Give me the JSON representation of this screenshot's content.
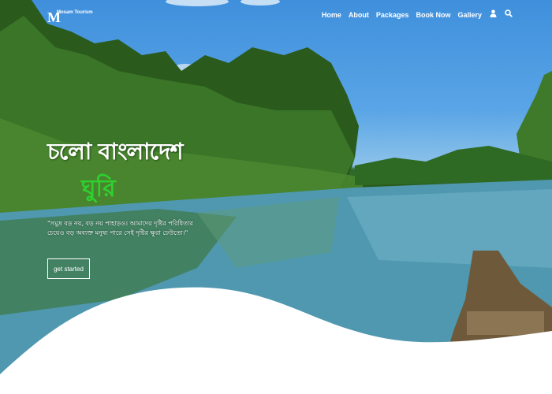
{
  "brand": {
    "logo_text": "Mosam Tourism"
  },
  "nav": {
    "items": [
      "Home",
      "About",
      "Packages",
      "Book Now",
      "Gallery"
    ],
    "user_icon": "user-icon",
    "search_icon": "search-icon"
  },
  "hero": {
    "headline": "চলো বাংলাদেশ",
    "subheadline": "ঘুরি",
    "description": "\"সমুদ্র বড় নয়, বড় নয় পাহাড়ও। আমাদের দৃষ্টির পরিধিতার চেয়েও বড় অব্যক্ত মনুষ্য পারে সেই দৃষ্টির ক্ষুরা ঢেউতো।\"",
    "button_label": "get started"
  }
}
